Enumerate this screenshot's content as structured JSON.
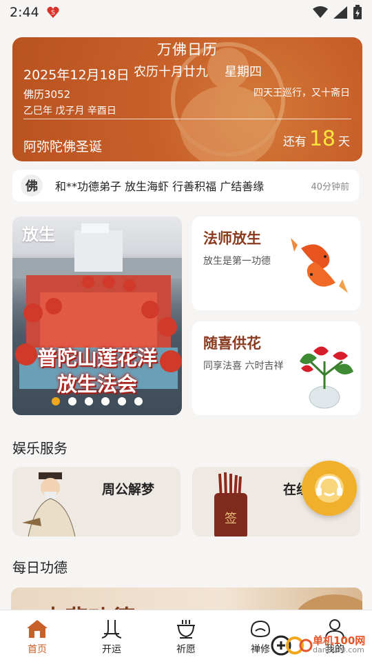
{
  "status_bar": {
    "time": "2:44"
  },
  "calendar": {
    "title": "万佛日历",
    "date": "2025年12月18日",
    "lunar": "农历十月廿九",
    "weekday": "星期四",
    "buddhist_year": "佛历3052",
    "observance": "四天王巡行，又十斋日",
    "ganzhi": "乙巳年 戊子月 辛酉日",
    "festival": "阿弥陀佛圣诞",
    "countdown_prefix": "还有",
    "countdown_days": "18",
    "countdown_suffix": "天"
  },
  "ticker": {
    "badge": "佛",
    "text": "和**功德弟子 放生海虾 行善积福 广结善缘",
    "time": "40分钟前"
  },
  "banner": {
    "label": "放生",
    "caption_line1": "普陀山莲花洋",
    "caption_line2": "放生法会",
    "slide_count": 6,
    "active_slide": 1
  },
  "cards": [
    {
      "title": "法师放生",
      "subtitle": "放生是第一功德",
      "icon": "koi-fish-icon"
    },
    {
      "title": "随喜供花",
      "subtitle": "同享法喜 六时吉祥",
      "icon": "anthurium-flower-icon"
    }
  ],
  "sections": {
    "entertainment": "娱乐服务",
    "daily_merit": "每日功德"
  },
  "entertainment_cards": [
    {
      "title": "周公解梦",
      "icon": "sage-icon"
    },
    {
      "title": "在线",
      "icon": "fortune-sticks-icon"
    }
  ],
  "daily_banner": {
    "partial_text": "大悲功德"
  },
  "bottom_nav": [
    {
      "label": "首页",
      "icon": "home-icon",
      "active": true
    },
    {
      "label": "开运",
      "icon": "luck-icon",
      "active": false
    },
    {
      "label": "祈愿",
      "icon": "incense-burner-icon",
      "active": false
    },
    {
      "label": "禅修",
      "icon": "meditation-icon",
      "active": false
    },
    {
      "label": "我的",
      "icon": "profile-icon",
      "active": false
    }
  ],
  "watermark": {
    "name": "单机100网",
    "url": "danji100.com"
  },
  "colors": {
    "accent": "#c8602a",
    "highlight": "#ffe53b",
    "fab": "#f0b02c",
    "card_title": "#8a3a1e"
  }
}
